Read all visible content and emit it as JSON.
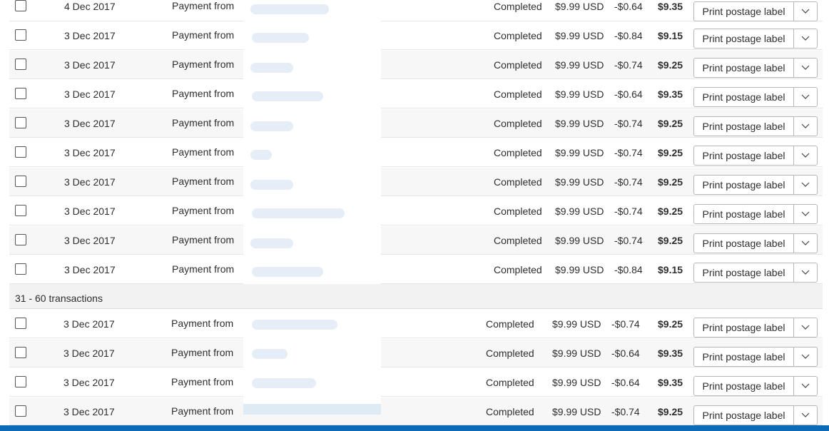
{
  "button": {
    "print_label": "Print postage label"
  },
  "section_header": "31 - 60 transactions",
  "colors": {
    "bottom_bar": "#0b6bb8",
    "row_alt": "#f7f7f7"
  },
  "icons": {
    "dropdown": "chevron-down-icon"
  },
  "rows_batch_1": [
    {
      "date": "4 Dec 2017",
      "description": "Payment from",
      "status": "Completed",
      "gross": "$9.99 USD",
      "fee": "-$0.64",
      "net": "$9.35"
    },
    {
      "date": "3 Dec 2017",
      "description": "Payment from",
      "status": "Completed",
      "gross": "$9.99 USD",
      "fee": "-$0.84",
      "net": "$9.15"
    },
    {
      "date": "3 Dec 2017",
      "description": "Payment from",
      "status": "Completed",
      "gross": "$9.99 USD",
      "fee": "-$0.74",
      "net": "$9.25"
    },
    {
      "date": "3 Dec 2017",
      "description": "Payment from",
      "status": "Completed",
      "gross": "$9.99 USD",
      "fee": "-$0.64",
      "net": "$9.35"
    },
    {
      "date": "3 Dec 2017",
      "description": "Payment from",
      "status": "Completed",
      "gross": "$9.99 USD",
      "fee": "-$0.74",
      "net": "$9.25"
    },
    {
      "date": "3 Dec 2017",
      "description": "Payment from",
      "status": "Completed",
      "gross": "$9.99 USD",
      "fee": "-$0.74",
      "net": "$9.25"
    },
    {
      "date": "3 Dec 2017",
      "description": "Payment from",
      "status": "Completed",
      "gross": "$9.99 USD",
      "fee": "-$0.74",
      "net": "$9.25"
    },
    {
      "date": "3 Dec 2017",
      "description": "Payment from",
      "status": "Completed",
      "gross": "$9.99 USD",
      "fee": "-$0.74",
      "net": "$9.25"
    },
    {
      "date": "3 Dec 2017",
      "description": "Payment from",
      "status": "Completed",
      "gross": "$9.99 USD",
      "fee": "-$0.74",
      "net": "$9.25"
    },
    {
      "date": "3 Dec 2017",
      "description": "Payment from",
      "status": "Completed",
      "gross": "$9.99 USD",
      "fee": "-$0.84",
      "net": "$9.15"
    }
  ],
  "rows_batch_2": [
    {
      "date": "3 Dec 2017",
      "description": "Payment from",
      "status": "Completed",
      "gross": "$9.99 USD",
      "fee": "-$0.74",
      "net": "$9.25"
    },
    {
      "date": "3 Dec 2017",
      "description": "Payment from",
      "status": "Completed",
      "gross": "$9.99 USD",
      "fee": "-$0.64",
      "net": "$9.35"
    },
    {
      "date": "3 Dec 2017",
      "description": "Payment from",
      "status": "Completed",
      "gross": "$9.99 USD",
      "fee": "-$0.64",
      "net": "$9.35"
    },
    {
      "date": "3 Dec 2017",
      "description": "Payment from",
      "status": "Completed",
      "gross": "$9.99 USD",
      "fee": "-$0.74",
      "net": "$9.25"
    }
  ]
}
